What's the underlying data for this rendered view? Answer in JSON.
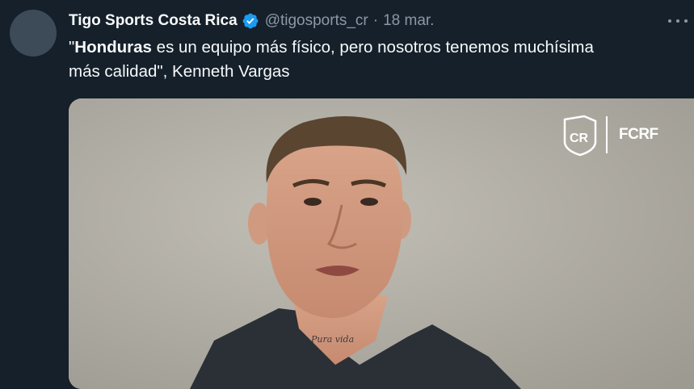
{
  "tweet": {
    "display_name": "Tigo Sports Costa Rica",
    "handle": "@tigosports_cr",
    "separator": "·",
    "date": "18 mar.",
    "text_bold": "Honduras",
    "text_open_quote": "\"",
    "text_rest_line1": " es un equipo más físico, pero nosotros tenemos muchísima",
    "text_line2": "más calidad\", Kenneth Vargas"
  },
  "media": {
    "logo_monogram": "CR",
    "logo_text": "FCRF",
    "tattoo_text": "Pura vida"
  },
  "colors": {
    "background": "#15202b",
    "verified_badge": "#1d9bf0",
    "secondary_text": "#8b98a5"
  },
  "icons": [
    "verified-badge-icon",
    "more-options-icon"
  ]
}
